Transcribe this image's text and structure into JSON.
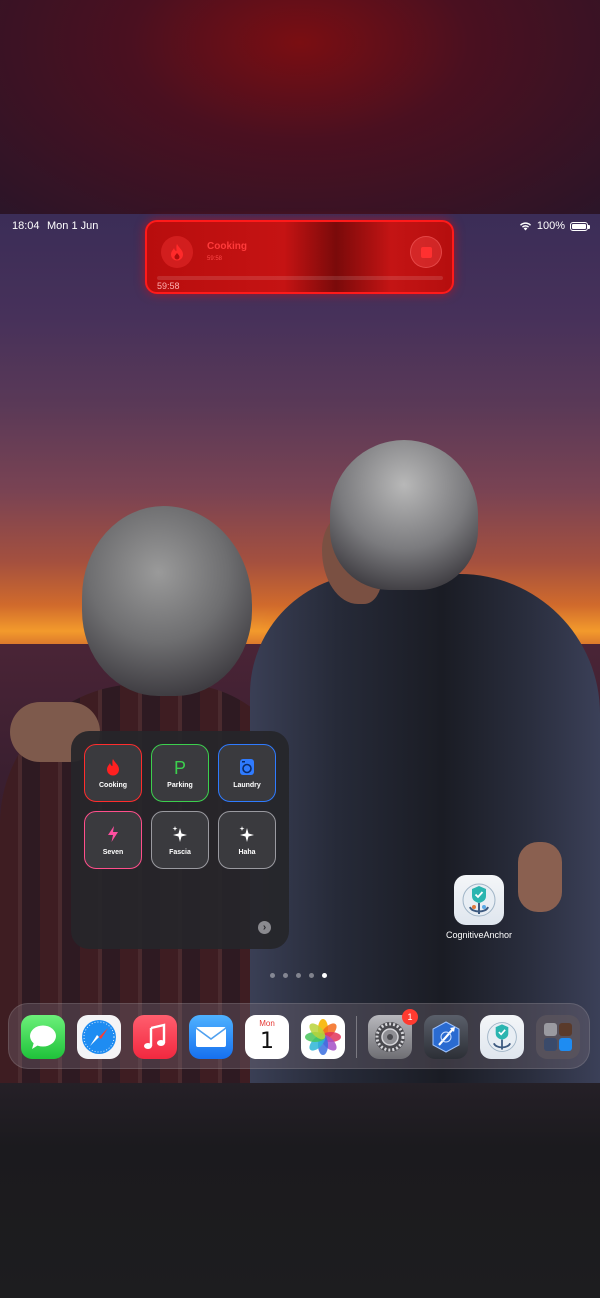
{
  "status_bar": {
    "time": "18:04",
    "date": "Mon 1 Jun",
    "battery": "100%"
  },
  "live_activity": {
    "title": "Cooking",
    "subtitle": "59:58",
    "timer": "59:58",
    "accent": "#ff1a1a"
  },
  "widget": {
    "tiles": [
      {
        "label": "Cooking",
        "glyph": "🔥",
        "color": "#ff2d2d"
      },
      {
        "label": "Parking",
        "glyph": "P",
        "color": "#3ccf4e"
      },
      {
        "label": "Laundry",
        "glyph": "▣",
        "color": "#2f7bff"
      },
      {
        "label": "Seven",
        "glyph": "⚡",
        "color": "#ff4fa0"
      },
      {
        "label": "Fascia",
        "glyph": "✦",
        "color": "#ffffff"
      },
      {
        "label": "Haha",
        "glyph": "✦",
        "color": "#ffffff"
      }
    ],
    "chevron": "›"
  },
  "home_app": {
    "label": "CognitiveAnchor",
    "icon": "anchor-app-icon"
  },
  "page_dots": {
    "count": 5,
    "active": 5
  },
  "dock": {
    "apps": [
      {
        "name": "Messages",
        "icon": "messages-icon"
      },
      {
        "name": "Safari",
        "icon": "safari-icon"
      },
      {
        "name": "Music",
        "icon": "music-icon"
      },
      {
        "name": "Mail",
        "icon": "mail-icon"
      },
      {
        "name": "Calendar",
        "icon": "calendar-icon",
        "day": "Mon",
        "date": "1"
      },
      {
        "name": "Photos",
        "icon": "photos-icon"
      },
      {
        "name": "Settings",
        "icon": "settings-icon",
        "badge": "1"
      },
      {
        "name": "Xcode",
        "icon": "xcode-icon"
      },
      {
        "name": "CognitiveAnchor",
        "icon": "anchor-app-icon"
      },
      {
        "name": "App Library",
        "icon": "app-library-icon"
      }
    ]
  }
}
